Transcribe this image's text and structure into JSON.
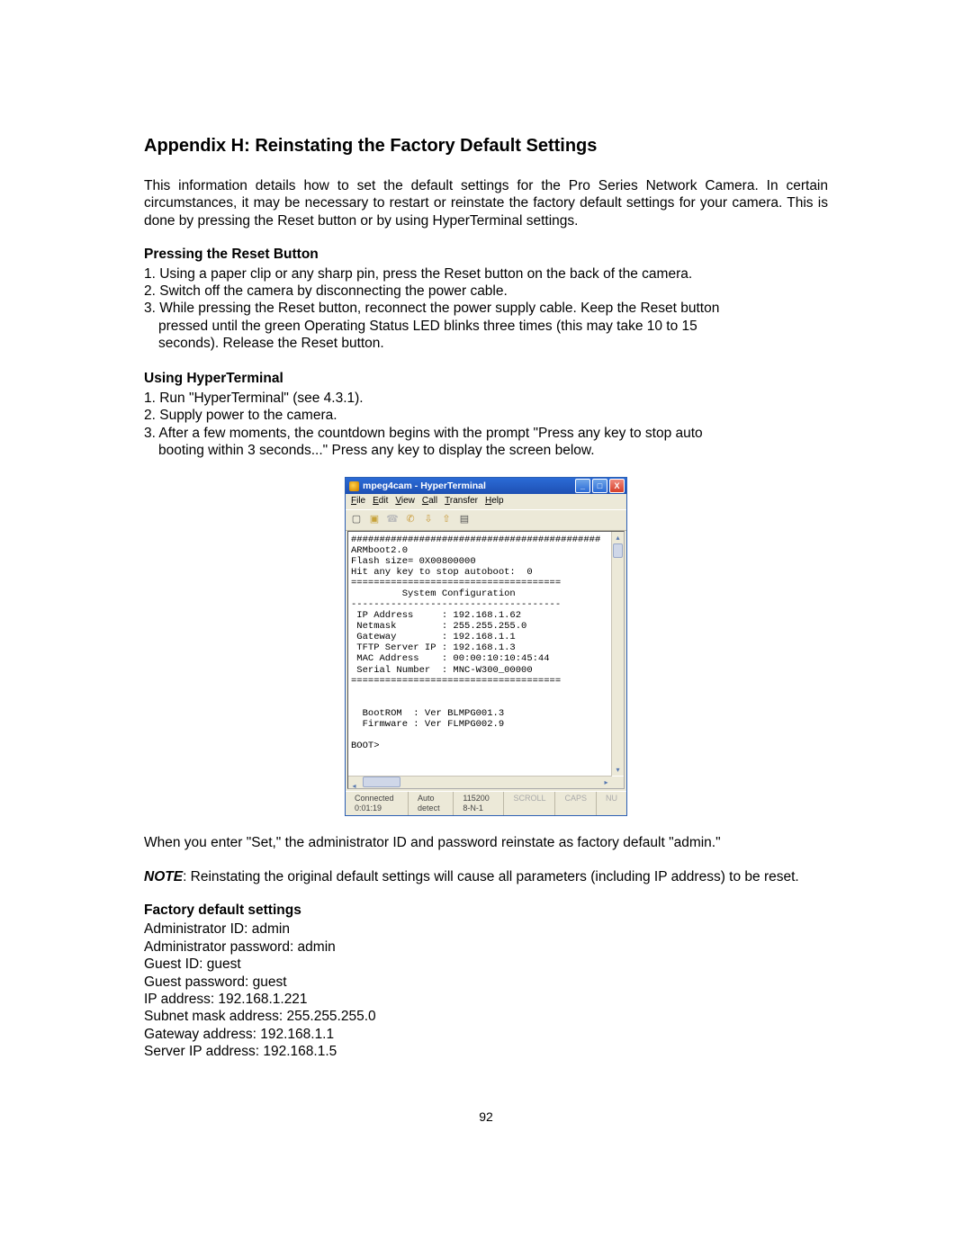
{
  "title": "Appendix H: Reinstating the Factory Default Settings",
  "intro": "This information details how to set the default settings for the Pro Series Network Camera. In certain circumstances, it may be necessary to restart or reinstate the factory default settings for your camera. This is done by pressing the Reset button or by using HyperTerminal settings.",
  "section1": {
    "heading": "Pressing the Reset Button",
    "i1": "1. Using a paper clip or any sharp pin, press the Reset button on the back of the camera.",
    "i2": "2. Switch off the camera by disconnecting the power cable.",
    "i3a": "3. While pressing the Reset button, reconnect the power supply cable. Keep the Reset button",
    "i3b": "pressed until the green Operating Status LED blinks three times (this may take 10 to 15",
    "i3c": "seconds). Release the Reset button."
  },
  "section2": {
    "heading": "Using HyperTerminal",
    "i1": "1. Run \"HyperTerminal\" (see 4.3.1).",
    "i2": "2. Supply power to the camera.",
    "i3a": "3. After a few moments, the countdown begins with the prompt \"Press any key to stop auto",
    "i3b": "booting within 3 seconds...\" Press any key to display the screen below."
  },
  "hyperterm": {
    "window_title": "mpeg4cam - HyperTerminal",
    "menu": {
      "file": "File",
      "edit": "Edit",
      "view": "View",
      "call": "Call",
      "transfer": "Transfer",
      "help": "Help"
    },
    "terminal_text": "############################################\nARMboot2.0\nFlash size= 0X00800000\nHit any key to stop autoboot:  0\n=====================================\n         System Configuration\n-------------------------------------\n IP Address     : 192.168.1.62\n Netmask        : 255.255.255.0\n Gateway        : 192.168.1.1\n TFTP Server IP : 192.168.1.3\n MAC Address    : 00:00:10:10:45:44\n Serial Number  : MNC-W300_00000\n=====================================\n\n\n  BootROM  : Ver BLMPG001.3\n  Firmware : Ver FLMPG002.9\n\nBOOT>",
    "status": {
      "conn": "Connected 0:01:19",
      "detect": "Auto detect",
      "baud": "115200 8-N-1",
      "scroll": "SCROLL",
      "caps": "CAPS",
      "num": "NU"
    }
  },
  "after_set": "When you enter \"Set,\" the administrator ID and password reinstate as factory default \"admin.\"",
  "note_label": "NOTE",
  "note_text": ": Reinstating the original default settings will cause all parameters (including IP address) to be reset.",
  "section3": {
    "heading": "Factory default settings",
    "l1": "Administrator ID: admin",
    "l2": "Administrator password: admin",
    "l3": "Guest ID: guest",
    "l4": "Guest password: guest",
    "l5": "IP address: 192.168.1.221",
    "l6": "Subnet mask address: 255.255.255.0",
    "l7": "Gateway address: 192.168.1.1",
    "l8": "Server IP address: 192.168.1.5"
  },
  "page_number": "92"
}
